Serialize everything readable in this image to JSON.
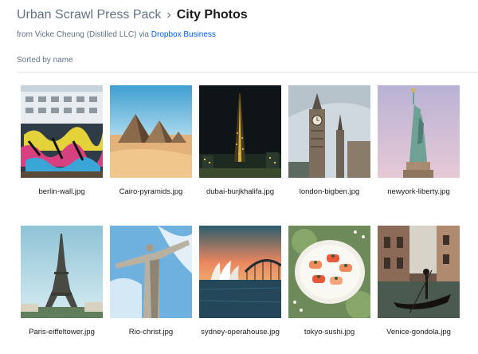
{
  "breadcrumb": {
    "parent": "Urban Scrawl Press Pack",
    "separator": "›",
    "current": "City Photos"
  },
  "share_info": {
    "prefix": "from Vicke Cheung (Distilled LLC) via",
    "link": "Dropbox Business"
  },
  "sort_label": "Sorted by name",
  "files": [
    {
      "name": "berlin-wall.jpg",
      "icon": "graffiti-wall-photo"
    },
    {
      "name": "Cairo-pyramids.jpg",
      "icon": "pyramids-photo"
    },
    {
      "name": "dubai-burjkhalifa.jpg",
      "icon": "skyscraper-night-photo"
    },
    {
      "name": "london-bigben.jpg",
      "icon": "clock-tower-photo"
    },
    {
      "name": "newyork-liberty.jpg",
      "icon": "statue-of-liberty-photo"
    },
    {
      "name": "Paris-eiffeltower.jpg",
      "icon": "eiffel-tower-photo"
    },
    {
      "name": "Rio-christ.jpg",
      "icon": "christ-statue-photo"
    },
    {
      "name": "sydney-operahouse.jpg",
      "icon": "opera-house-photo"
    },
    {
      "name": "tokyo-sushi.jpg",
      "icon": "sushi-plate-photo"
    },
    {
      "name": "Venice-gondola.jpg",
      "icon": "gondola-canal-photo"
    }
  ],
  "colors": {
    "link": "#0061fe",
    "muted_text": "#637282",
    "primary_text": "#1e1919"
  }
}
